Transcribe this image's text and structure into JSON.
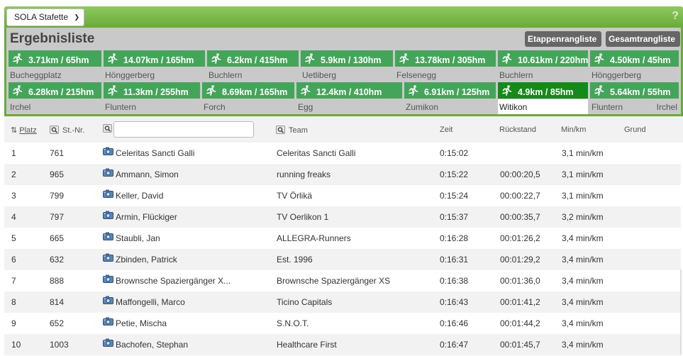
{
  "topbar": {
    "event_select": "SOLA Stafette",
    "help": "?"
  },
  "panel": {
    "title": "Ergebnisliste",
    "btn_etappen": "Etappenrangliste",
    "btn_gesamt": "Gesamtrangliste"
  },
  "legs_row1": [
    {
      "dist": "3.71km / 65hm",
      "loc": "Bucheggplatz"
    },
    {
      "dist": "14.07km / 165hm",
      "loc": "Hönggerberg"
    },
    {
      "dist": "6.2km / 415hm",
      "loc": "Buchlern"
    },
    {
      "dist": "5.9km / 130hm",
      "loc": "Uetliberg"
    },
    {
      "dist": "13.78km / 305hm",
      "loc": "Felsenegg"
    },
    {
      "dist": "10.61km / 220hm",
      "loc": "Buchlern"
    },
    {
      "dist": "4.50km / 45hm",
      "loc": "Hönggerberg"
    }
  ],
  "legs_row2": [
    {
      "dist": "6.28km / 215hm",
      "loc": "Irchel"
    },
    {
      "dist": "11.3km / 255hm",
      "loc": "Fluntern"
    },
    {
      "dist": "8.69km / 165hm",
      "loc": "Forch"
    },
    {
      "dist": "12.4km / 410hm",
      "loc": "Egg"
    },
    {
      "dist": "6.91km / 125hm",
      "loc": "Zumikon"
    },
    {
      "dist": "4.9km / 85hm",
      "loc": "Witikon"
    },
    {
      "dist": "5.64km / 55hm",
      "loc": "Fluntern",
      "loc_end": "Irchel"
    }
  ],
  "table": {
    "headers": {
      "place": "Platz",
      "place_sort": "⇅",
      "stnr": "St.-Nr.",
      "team": "Team",
      "zeit": "Zeit",
      "rueck": "Rückstand",
      "minkm": "Min/km",
      "grund": "Grund"
    },
    "name_filter_placeholder": "",
    "rows": [
      {
        "place": "1",
        "stnr": "761",
        "name": "Celeritas Sancti Galli",
        "team": "Celeritas Sancti Galli",
        "zeit": "0:15:02",
        "rueck": "",
        "minkm": "3,1 min/km"
      },
      {
        "place": "2",
        "stnr": "965",
        "name": "Ammann, Simon",
        "team": "running freaks",
        "zeit": "0:15:22",
        "rueck": "00:00:20,5",
        "minkm": "3,1 min/km"
      },
      {
        "place": "3",
        "stnr": "799",
        "name": "Keller, David",
        "team": "TV Örlikä",
        "zeit": "0:15:24",
        "rueck": "00:00:22,7",
        "minkm": "3,1 min/km"
      },
      {
        "place": "4",
        "stnr": "797",
        "name": "Armin, Flückiger",
        "team": "TV Oerlikon 1",
        "zeit": "0:15:37",
        "rueck": "00:00:35,7",
        "minkm": "3,2 min/km"
      },
      {
        "place": "5",
        "stnr": "665",
        "name": "Staubli, Jan",
        "team": "ALLEGRA-Runners",
        "zeit": "0:16:28",
        "rueck": "00:01:26,2",
        "minkm": "3,4 min/km"
      },
      {
        "place": "6",
        "stnr": "632",
        "name": "Zbinden, Patrick",
        "team": "Est. 1996",
        "zeit": "0:16:31",
        "rueck": "00:01:29,2",
        "minkm": "3,4 min/km"
      },
      {
        "place": "7",
        "stnr": "888",
        "name": "Brownsche Spaziergänger X...",
        "team": "Brownsche Spaziergänger XS",
        "zeit": "0:16:38",
        "rueck": "00:01:36,0",
        "minkm": "3,4 min/km"
      },
      {
        "place": "8",
        "stnr": "814",
        "name": "Maffongelli, Marco",
        "team": "Ticino Capitals",
        "zeit": "0:16:43",
        "rueck": "00:01:41,2",
        "minkm": "3,4 min/km"
      },
      {
        "place": "9",
        "stnr": "652",
        "name": "Petie, Mischa",
        "team": "S.N.O.T.",
        "zeit": "0:16:46",
        "rueck": "00:01:44,2",
        "minkm": "3,4 min/km"
      },
      {
        "place": "10",
        "stnr": "1003",
        "name": "Bachofen, Stephan",
        "team": "Healthcare First",
        "zeit": "0:16:47",
        "rueck": "00:01:45,7",
        "minkm": "3,4 min/km"
      }
    ]
  },
  "colors": {
    "green_bar": "#44a55a",
    "green_active": "#148a1a",
    "topbar": "#7ab94b"
  }
}
